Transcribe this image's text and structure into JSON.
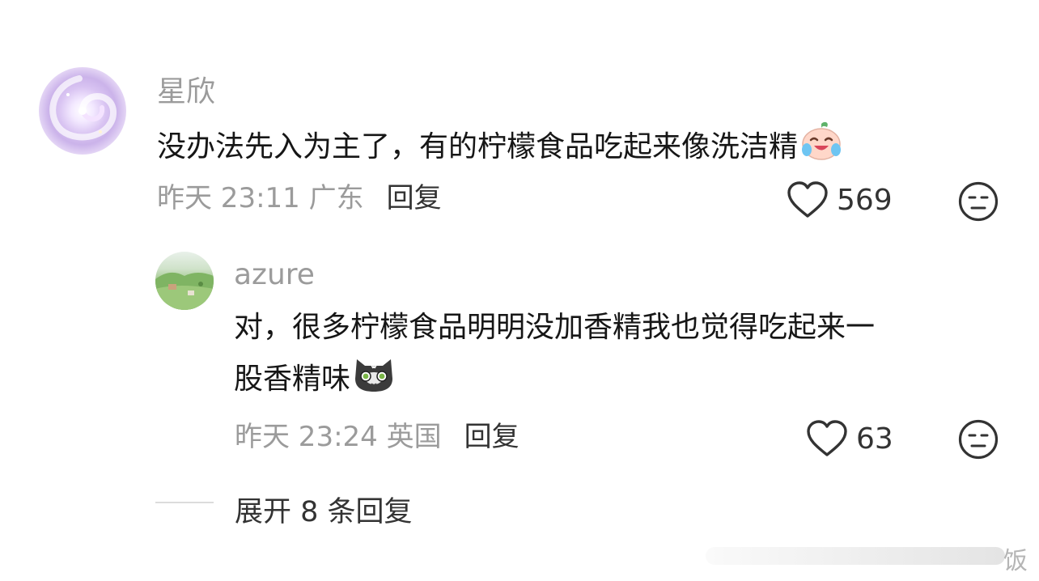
{
  "comment": {
    "username": "星欣",
    "text": "没办法先入为主了，有的柠檬食品吃起来像洗洁精",
    "time": "昨天 23:11",
    "location": "广东",
    "reply_label": "回复",
    "likes": "569",
    "emoji": "crying-laughing-face-emoji"
  },
  "reply": {
    "username": "azure",
    "text_line1": "对，很多柠檬食品明明没加香精我也觉得吃起来一",
    "text_line2": "股香精味",
    "time": "昨天 23:24",
    "location": "英国",
    "reply_label": "回复",
    "likes": "63",
    "emoji": "cat-face-emoji"
  },
  "expand_replies": "展开 8 条回复",
  "watermark": "饭",
  "icons": {
    "like": "heart-outline-icon",
    "dislike": "meh-face-icon"
  },
  "colors": {
    "text": "#161616",
    "secondary": "#9b9b9b",
    "action": "#333333"
  }
}
